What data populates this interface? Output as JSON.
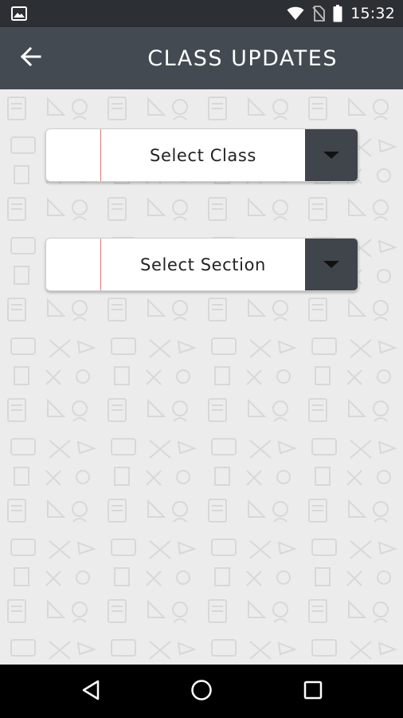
{
  "status_bar": {
    "time": "15:32",
    "icons": [
      "image-icon",
      "wifi-icon",
      "no-sim-icon",
      "battery-icon"
    ]
  },
  "app_bar": {
    "title": "CLASS UPDATES",
    "back_icon": "back-arrow-icon"
  },
  "form": {
    "class_dropdown": {
      "label": "Select Class",
      "icon": "caret-down-icon"
    },
    "section_dropdown": {
      "label": "Select Section",
      "icon": "caret-down-icon"
    }
  },
  "nav_bar": {
    "buttons": [
      "back-triangle-icon",
      "home-circle-icon",
      "recents-square-icon"
    ]
  },
  "colors": {
    "status_bar": "#2c3034",
    "app_bar": "#434a51",
    "background": "#ececec",
    "dropdown_button": "#3f454b",
    "divider_red": "#e07a7a"
  }
}
